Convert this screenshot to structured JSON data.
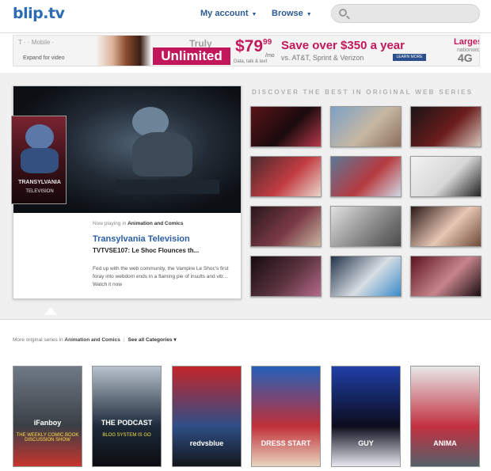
{
  "header": {
    "logo": "blip.tv",
    "nav": [
      {
        "label": "My account"
      },
      {
        "label": "Browse"
      }
    ],
    "search": {
      "placeholder": "",
      "value": ""
    }
  },
  "ad": {
    "brand": "T · · Mobile ·",
    "expand": "Expand for video",
    "truly": "Truly",
    "unlimited": "Unlimited",
    "price_main": "$79",
    "price_cents": "99",
    "per_mo": "/mo",
    "details": "Data, talk & text",
    "save": "Save over $350 a year",
    "vs": "vs. AT&T, Sprint & Verizon",
    "learn": "LEARN MORE",
    "largest": "Largest",
    "network": "nationwide",
    "fourg": "4G"
  },
  "featured": {
    "now_playing_prefix": "Now playing in",
    "category": "Animation and Comics",
    "show_title": "Transylvania Television",
    "episode_title": "TVTVSE107: Le Shoc Flounces th...",
    "description": "Fed up with the web community, the Vampire Le Shoc's first foray into webdom ends in a flaming pie of insults and vitr... Watch it now",
    "poster_title": "TRANSYLVANIA",
    "poster_sub": "TELEVISION"
  },
  "discover": {
    "heading": "DISCOVER THE BEST IN ORIGINAL WEB SERIES",
    "thumbs": [
      {
        "name": "thumb-1",
        "colors": [
          "#5a1418",
          "#1a0b0e",
          "#b8374a"
        ]
      },
      {
        "name": "thumb-2",
        "colors": [
          "#7da0c6",
          "#c7b8a3",
          "#8a6e5a"
        ]
      },
      {
        "name": "thumb-3",
        "colors": [
          "#1a1416",
          "#6a1c1c",
          "#d7c5b8"
        ]
      },
      {
        "name": "thumb-4",
        "colors": [
          "#4a2a2e",
          "#c23c42",
          "#e8d6cb"
        ]
      },
      {
        "name": "thumb-5",
        "colors": [
          "#5b7896",
          "#b73940",
          "#cfd8e2"
        ]
      },
      {
        "name": "thumb-6",
        "colors": [
          "#f2f2f2",
          "#d7d7d7",
          "#222222"
        ]
      },
      {
        "name": "thumb-7",
        "colors": [
          "#28181c",
          "#7a3a46",
          "#c8b4a0"
        ]
      },
      {
        "name": "thumb-8",
        "colors": [
          "#e1e1e1",
          "#8a8a8a",
          "#4a4a4a"
        ]
      },
      {
        "name": "thumb-9",
        "colors": [
          "#2a1a18",
          "#e8c6b4",
          "#6e4a38"
        ]
      },
      {
        "name": "thumb-10",
        "colors": [
          "#140c10",
          "#5c3440",
          "#b56a8a"
        ]
      },
      {
        "name": "thumb-11",
        "colors": [
          "#22344a",
          "#d8dee4",
          "#3a8ac8"
        ]
      },
      {
        "name": "thumb-12",
        "colors": [
          "#5a1420",
          "#c8848c",
          "#1a0e12"
        ]
      }
    ]
  },
  "more": {
    "prefix": "More original series in",
    "category": "Animation and Comics",
    "see_all": "See all Categories"
  },
  "series": [
    {
      "title": "iFanboy",
      "sub": "THE WEEKLY COMIC BOOK DISCUSSION SHOW",
      "colors": [
        "#6f7a86",
        "#3a3f45",
        "#c8352e"
      ]
    },
    {
      "title": "THE PODCAST",
      "sub": "BLOG SYSTEM IS GO",
      "colors": [
        "#b8c2cc",
        "#1c2a3a",
        "#0c0c10"
      ]
    },
    {
      "title": "redvsblue",
      "sub": "",
      "colors": [
        "#c2252a",
        "#2e4f86",
        "#15151a"
      ]
    },
    {
      "title": "DRESS START",
      "sub": "",
      "colors": [
        "#2460b8",
        "#c03038",
        "#e8d6c0"
      ]
    },
    {
      "title": "GUY",
      "sub": "",
      "colors": [
        "#2040a8",
        "#0c0c1c",
        "#e8e8f0"
      ]
    },
    {
      "title": "ANIMA",
      "sub": "",
      "colors": [
        "#e8e8e8",
        "#c23040",
        "#55606a"
      ]
    }
  ]
}
